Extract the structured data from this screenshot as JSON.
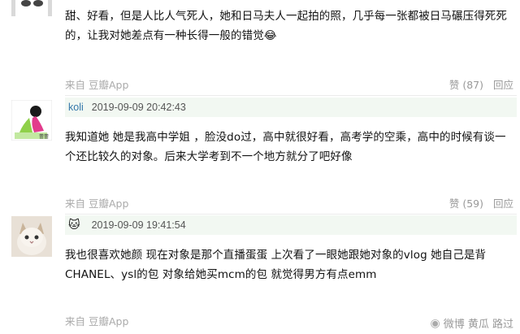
{
  "comments": [
    {
      "text": "甜、好看，但是人比人气死人，她和日马夫人一起拍的照，几乎每一张都被日马碾压得死死的，让我对她差点有一种长得一般的错觉😂",
      "source": "来自 豆瓣App",
      "likes": "赞 (87)",
      "reply": "回应"
    },
    {
      "username": "koli",
      "timestamp": "2019-09-09 20:42:43",
      "text": "我知道她 她是我高中学姐 ，脸没do过，高中就很好看，高考学的空乘，高中的时候有谈一个还比较久的对象。后来大学考到不一个地方就分了吧好像",
      "source": "来自 豆瓣App",
      "likes": "赞 (59)",
      "reply": "回应"
    },
    {
      "badge": "🐱",
      "timestamp": "2019-09-09 19:41:54",
      "text": "我也很喜欢她颜 现在对象是那个直播蛋蛋 上次看了一眼她跟她对象的vlog 她自己是背CHANEL、ysl的包 对象给她买mcm的包 就觉得男方有点emm",
      "source": "来自 豆瓣App"
    }
  ],
  "avatar2_label": "蕾蕾",
  "watermark": "微博 黄瓜 路过",
  "colors": {
    "username": "#3377aa",
    "meta_bg": "#f2f8f2",
    "footer_text": "#aaaaaa"
  }
}
